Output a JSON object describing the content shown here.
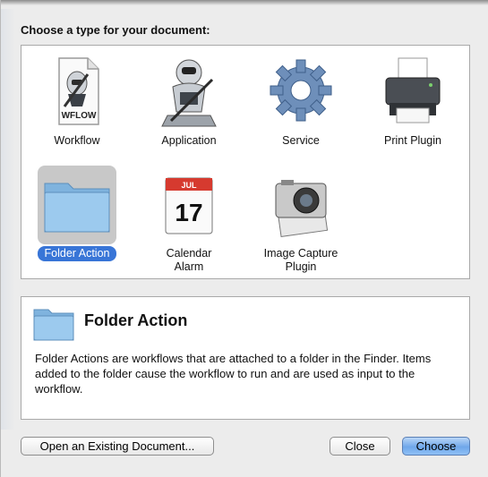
{
  "dialog": {
    "prompt": "Choose a type for your document:"
  },
  "types": [
    {
      "label": "Workflow",
      "icon": "workflow-document-icon",
      "doc_tag": "WFLOW"
    },
    {
      "label": "Application",
      "icon": "automator-robot-icon"
    },
    {
      "label": "Service",
      "icon": "gear-icon"
    },
    {
      "label": "Print Plugin",
      "icon": "printer-icon"
    },
    {
      "label": "Folder Action",
      "icon": "blue-folder-icon",
      "selected": true
    },
    {
      "label": "Calendar Alarm",
      "icon": "calendar-icon",
      "month": "JUL",
      "day": "17"
    },
    {
      "label": "Image Capture\nPlugin",
      "icon": "camera-icon"
    }
  ],
  "info": {
    "title": "Folder Action",
    "icon": "blue-folder-icon",
    "description": "Folder Actions are workflows that are attached to a folder in the Finder. Items added to the folder cause the workflow to run and are used as input to the workflow."
  },
  "buttons": {
    "open_existing": "Open an Existing Document...",
    "close": "Close",
    "choose": "Choose"
  },
  "colors": {
    "selection": "#3875d7",
    "folder_blue": "#8cc3ea",
    "default_button": "#6fa7ea"
  }
}
